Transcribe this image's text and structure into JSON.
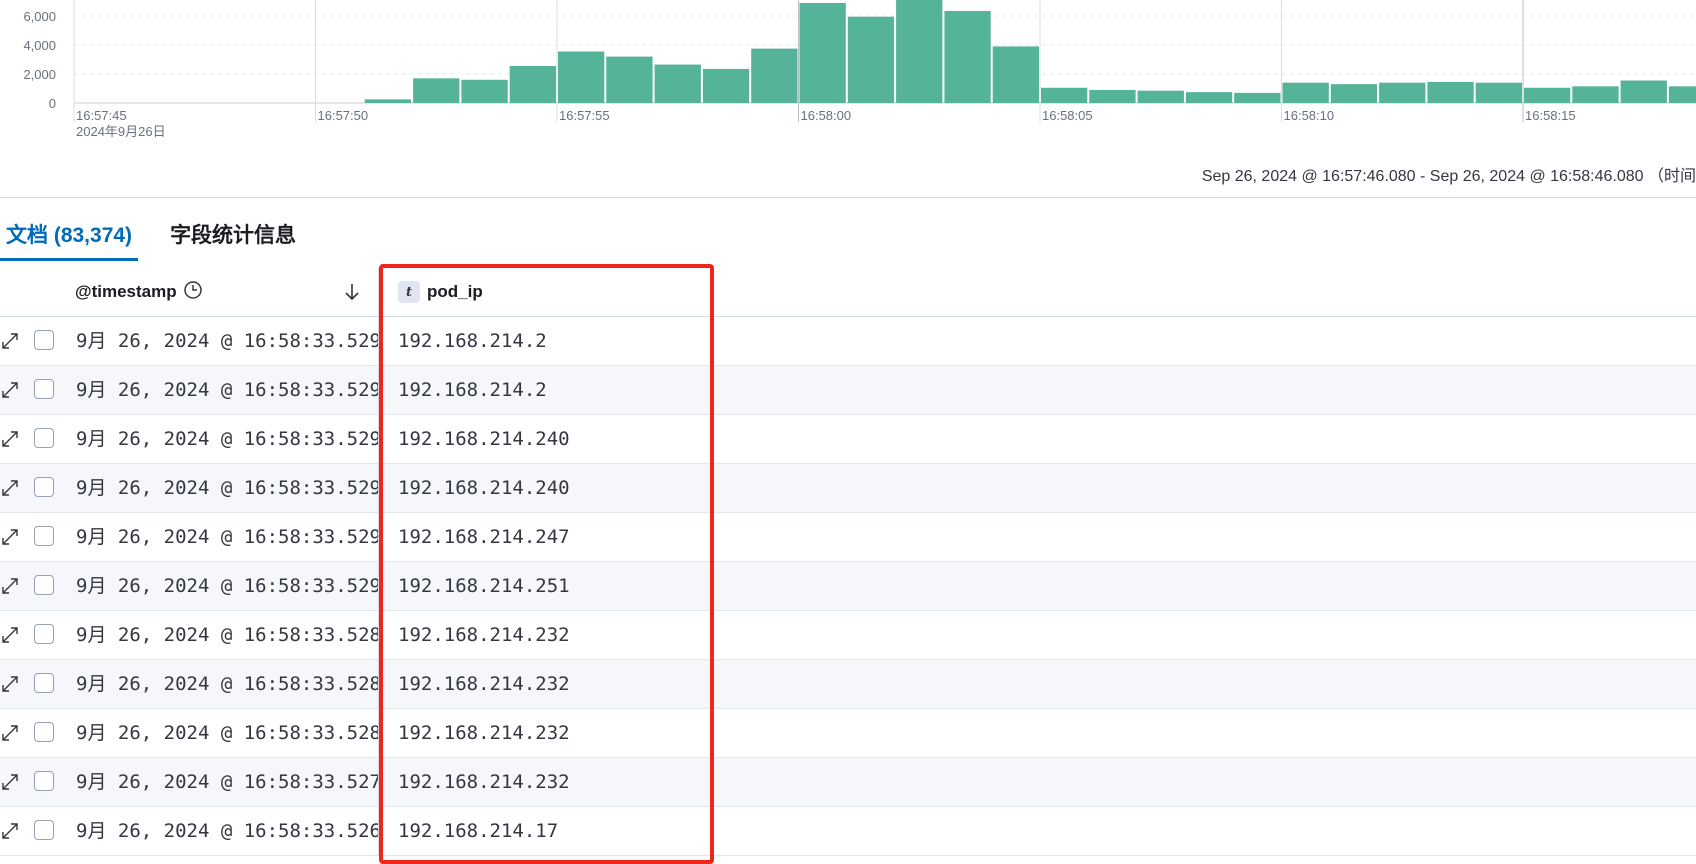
{
  "chart_data": {
    "type": "bar",
    "y_ticks": [
      "0",
      "2,000",
      "4,000",
      "6,000"
    ],
    "y_ticks_values": [
      0,
      2000,
      4000,
      6000
    ],
    "ylim": [
      0,
      8000
    ],
    "x_ticks": [
      "16:57:45",
      "16:57:50",
      "16:57:55",
      "16:58:00",
      "16:58:05",
      "16:58:10",
      "16:58:15"
    ],
    "x_date_label": "2024年9月26日",
    "bar_interval_seconds": 1,
    "first_bar_time": "16:57:50",
    "values": [
      0,
      250,
      1700,
      1600,
      2550,
      3550,
      3200,
      2650,
      2350,
      3750,
      6900,
      5950,
      7250,
      6350,
      3900,
      1050,
      900,
      850,
      750,
      700,
      1400,
      1300,
      1400,
      1450,
      1400,
      1050,
      1150,
      1550,
      1150,
      700
    ],
    "bar_color": "#54b399",
    "grid": true
  },
  "time_range": "Sep 26, 2024 @ 16:57:46.080 - Sep 26, 2024 @ 16:58:46.080 （时间",
  "tabs": [
    {
      "label": "文档 (83,374)",
      "active": true
    },
    {
      "label": "字段统计信息",
      "active": false
    }
  ],
  "columns": {
    "timestamp": "@timestamp",
    "pod_ip": "pod_ip",
    "pod_ip_type": "t"
  },
  "rows": [
    {
      "timestamp": "9月 26, 2024 @ 16:58:33.529",
      "pod_ip": "192.168.214.2"
    },
    {
      "timestamp": "9月 26, 2024 @ 16:58:33.529",
      "pod_ip": "192.168.214.2"
    },
    {
      "timestamp": "9月 26, 2024 @ 16:58:33.529",
      "pod_ip": "192.168.214.240"
    },
    {
      "timestamp": "9月 26, 2024 @ 16:58:33.529",
      "pod_ip": "192.168.214.240"
    },
    {
      "timestamp": "9月 26, 2024 @ 16:58:33.529",
      "pod_ip": "192.168.214.247"
    },
    {
      "timestamp": "9月 26, 2024 @ 16:58:33.529",
      "pod_ip": "192.168.214.251"
    },
    {
      "timestamp": "9月 26, 2024 @ 16:58:33.528",
      "pod_ip": "192.168.214.232"
    },
    {
      "timestamp": "9月 26, 2024 @ 16:58:33.528",
      "pod_ip": "192.168.214.232"
    },
    {
      "timestamp": "9月 26, 2024 @ 16:58:33.528",
      "pod_ip": "192.168.214.232"
    },
    {
      "timestamp": "9月 26, 2024 @ 16:58:33.527",
      "pod_ip": "192.168.214.232"
    },
    {
      "timestamp": "9月 26, 2024 @ 16:58:33.526",
      "pod_ip": "192.168.214.17"
    }
  ],
  "highlight_color": "#f0251b"
}
